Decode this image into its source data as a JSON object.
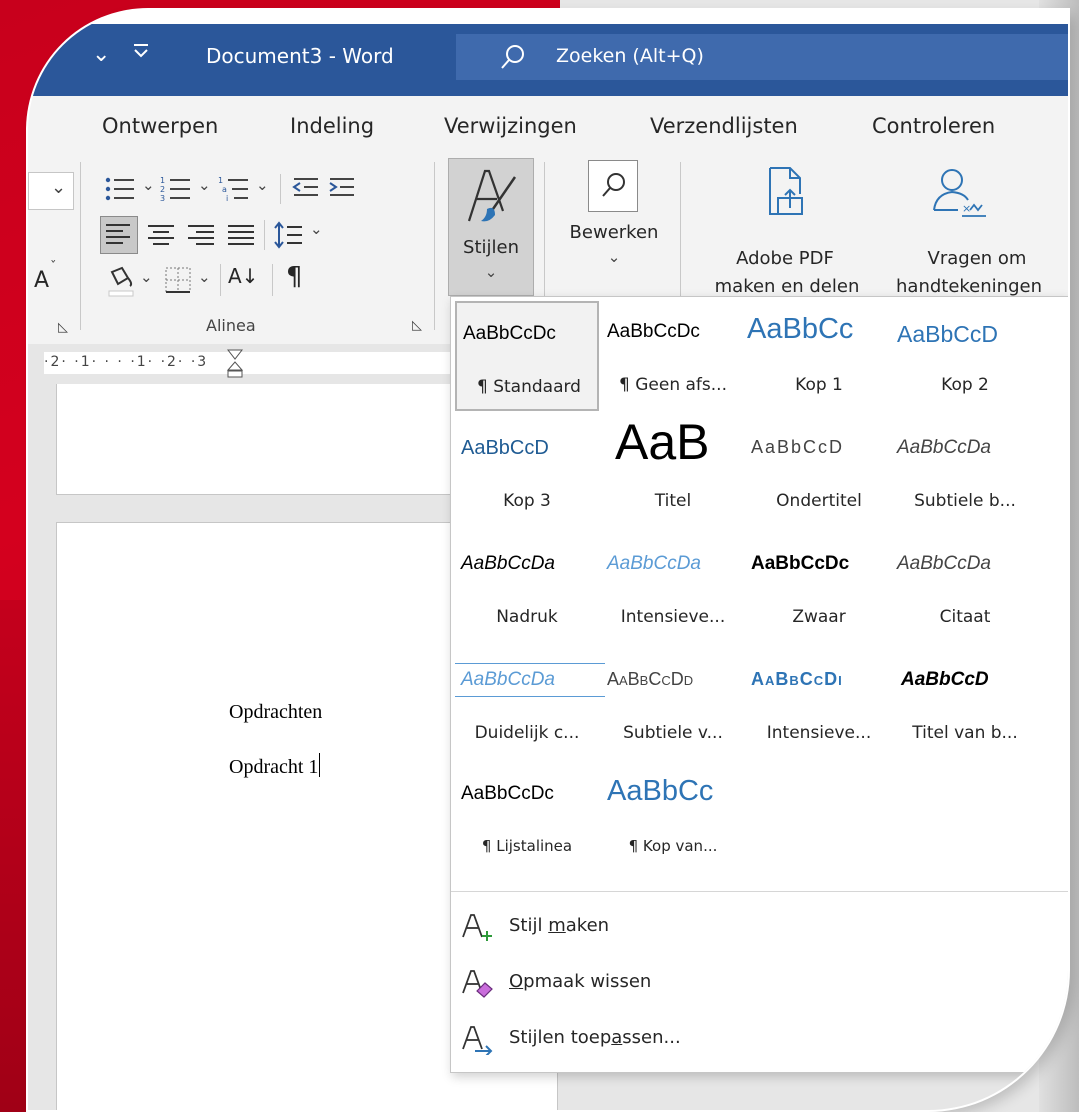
{
  "titlebar": {
    "title": "Document3  -  Word",
    "search_placeholder": "Zoeken (Alt+Q)"
  },
  "menu_tabs": [
    "Ontwerpen",
    "Indeling",
    "Verwijzingen",
    "Verzendlijsten",
    "Controleren"
  ],
  "ribbon": {
    "font_size_glyph": "A",
    "group_label": "Alinea",
    "stijlen_label": "Stijlen",
    "bewerken_label": "Bewerken",
    "adobe_line1": "Adobe PDF",
    "adobe_line2": "maken en delen",
    "vragen_line1": "Vragen om",
    "vragen_line2": "handtekeningen",
    "pilcrow": "¶",
    "sort_glyph": "A↓",
    "chevron": "⌄"
  },
  "ruler": {
    "text": "·2·  ·1·  ·  ·  ·1·  ·2·  ·3"
  },
  "document": {
    "line1": "Opdrachten",
    "line2": "Opdracht 1"
  },
  "gallery": {
    "styles": [
      {
        "preview": "AaBbCcDc",
        "name": "¶ Standaard"
      },
      {
        "preview": "AaBbCcDc",
        "name": "¶ Geen afs..."
      },
      {
        "preview": "AaBbCc",
        "name": "Kop 1"
      },
      {
        "preview": "AaBbCcD",
        "name": "Kop 2"
      },
      {
        "preview": "AaBbCcD",
        "name": "Kop 3"
      },
      {
        "preview": "AaB",
        "name": "Titel"
      },
      {
        "preview": "AaBbCcD",
        "name": "Ondertitel"
      },
      {
        "preview": "AaBbCcDa",
        "name": "Subtiele b..."
      },
      {
        "preview": "AaBbCcDa",
        "name": "Nadruk"
      },
      {
        "preview": "AaBbCcDa",
        "name": "Intensieve..."
      },
      {
        "preview": "AaBbCcDc",
        "name": "Zwaar"
      },
      {
        "preview": "AaBbCcDa",
        "name": "Citaat"
      },
      {
        "preview": "AaBbCcDa",
        "name": "Duidelijk c..."
      },
      {
        "preview": "AaBbCcDd",
        "name": "Subtiele v..."
      },
      {
        "preview": "AaBbCcDi",
        "name": "Intensieve..."
      },
      {
        "preview": "AaBbCcD",
        "name": "Titel van b..."
      },
      {
        "preview": "AaBbCcDc",
        "name": "¶ Lijstalinea"
      },
      {
        "preview": "AaBbCc",
        "name": "¶ Kop van..."
      }
    ],
    "actions": {
      "create_pre": "Stijl ",
      "create_u": "m",
      "create_post": "aken",
      "clear_u": "O",
      "clear_post": "pmaak wissen",
      "apply_pre": "Stijlen toep",
      "apply_u": "a",
      "apply_post": "ssen..."
    }
  },
  "colors": {
    "title_bar": "#2b579a",
    "heading_blue": "#2e74b5",
    "light_blue": "#5b9bd5",
    "frame_red": "#c8001c"
  }
}
